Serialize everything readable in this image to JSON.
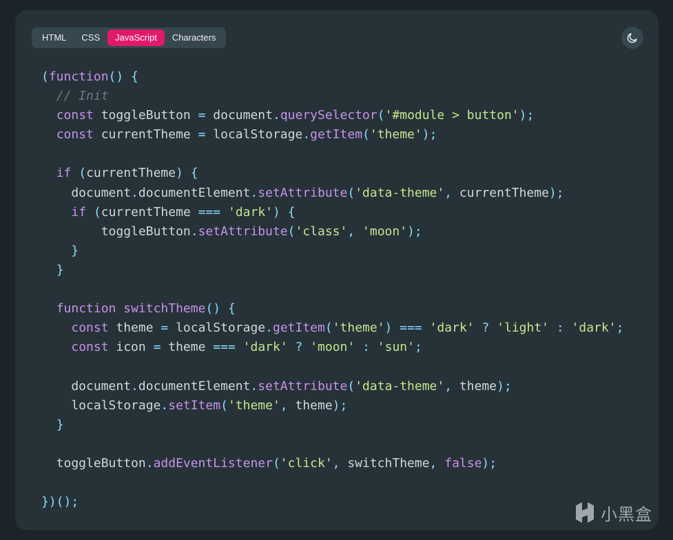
{
  "tabs": [
    {
      "label": "HTML",
      "active": false
    },
    {
      "label": "CSS",
      "active": false
    },
    {
      "label": "JavaScript",
      "active": true
    },
    {
      "label": "Characters",
      "active": false
    }
  ],
  "theme_toggle": {
    "icon": "moon-icon"
  },
  "colors": {
    "background": "#1b2428",
    "panel": "#263238",
    "tab_bar": "#37474f",
    "active_tab": "#e0196b",
    "keyword": "#c792ea",
    "string": "#c3e88d",
    "punctuation": "#89ddff",
    "comment": "#697b84",
    "text": "#cfd8dc"
  },
  "code": {
    "language": "JavaScript",
    "lines": [
      [
        [
          "punc",
          "("
        ],
        [
          "kw",
          "function"
        ],
        [
          "punc",
          "()"
        ],
        [
          "txt",
          " "
        ],
        [
          "punc",
          "{"
        ]
      ],
      [
        [
          "cm",
          "  // Init"
        ]
      ],
      [
        [
          "txt",
          "  "
        ],
        [
          "kw",
          "const"
        ],
        [
          "txt",
          " toggleButton "
        ],
        [
          "punc",
          "="
        ],
        [
          "txt",
          " document"
        ],
        [
          "dot",
          "."
        ],
        [
          "fn",
          "querySelector"
        ],
        [
          "punc",
          "("
        ],
        [
          "str",
          "'#module > button'"
        ],
        [
          "punc",
          ");"
        ]
      ],
      [
        [
          "txt",
          "  "
        ],
        [
          "kw",
          "const"
        ],
        [
          "txt",
          " currentTheme "
        ],
        [
          "punc",
          "="
        ],
        [
          "txt",
          " localStorage"
        ],
        [
          "dot",
          "."
        ],
        [
          "fn",
          "getItem"
        ],
        [
          "punc",
          "("
        ],
        [
          "str",
          "'theme'"
        ],
        [
          "punc",
          ");"
        ]
      ],
      [],
      [
        [
          "txt",
          "  "
        ],
        [
          "kw",
          "if"
        ],
        [
          "txt",
          " "
        ],
        [
          "punc",
          "("
        ],
        [
          "txt",
          "currentTheme"
        ],
        [
          "punc",
          ")"
        ],
        [
          "txt",
          " "
        ],
        [
          "punc",
          "{"
        ]
      ],
      [
        [
          "txt",
          "    document"
        ],
        [
          "dot",
          "."
        ],
        [
          "txt",
          "documentElement"
        ],
        [
          "dot",
          "."
        ],
        [
          "fn",
          "setAttribute"
        ],
        [
          "punc",
          "("
        ],
        [
          "str",
          "'data-theme'"
        ],
        [
          "punc",
          ","
        ],
        [
          "txt",
          " currentTheme"
        ],
        [
          "punc",
          ");"
        ]
      ],
      [
        [
          "txt",
          "    "
        ],
        [
          "kw",
          "if"
        ],
        [
          "txt",
          " "
        ],
        [
          "punc",
          "("
        ],
        [
          "txt",
          "currentTheme "
        ],
        [
          "punc",
          "==="
        ],
        [
          "txt",
          " "
        ],
        [
          "str",
          "'dark'"
        ],
        [
          "punc",
          ")"
        ],
        [
          "txt",
          " "
        ],
        [
          "punc",
          "{"
        ]
      ],
      [
        [
          "txt",
          "        toggleButton"
        ],
        [
          "dot",
          "."
        ],
        [
          "fn",
          "setAttribute"
        ],
        [
          "punc",
          "("
        ],
        [
          "str",
          "'class'"
        ],
        [
          "punc",
          ","
        ],
        [
          "txt",
          " "
        ],
        [
          "str",
          "'moon'"
        ],
        [
          "punc",
          ");"
        ]
      ],
      [
        [
          "txt",
          "    "
        ],
        [
          "punc",
          "}"
        ]
      ],
      [
        [
          "txt",
          "  "
        ],
        [
          "punc",
          "}"
        ]
      ],
      [],
      [
        [
          "txt",
          "  "
        ],
        [
          "kw",
          "function"
        ],
        [
          "txt",
          " "
        ],
        [
          "fn",
          "switchTheme"
        ],
        [
          "punc",
          "()"
        ],
        [
          "txt",
          " "
        ],
        [
          "punc",
          "{"
        ]
      ],
      [
        [
          "txt",
          "    "
        ],
        [
          "kw",
          "const"
        ],
        [
          "txt",
          " theme "
        ],
        [
          "punc",
          "="
        ],
        [
          "txt",
          " localStorage"
        ],
        [
          "dot",
          "."
        ],
        [
          "fn",
          "getItem"
        ],
        [
          "punc",
          "("
        ],
        [
          "str",
          "'theme'"
        ],
        [
          "punc",
          ")"
        ],
        [
          "txt",
          " "
        ],
        [
          "punc",
          "==="
        ],
        [
          "txt",
          " "
        ],
        [
          "str",
          "'dark'"
        ],
        [
          "txt",
          " "
        ],
        [
          "punc",
          "?"
        ],
        [
          "txt",
          " "
        ],
        [
          "str",
          "'light'"
        ],
        [
          "txt",
          " "
        ],
        [
          "punc",
          ":"
        ],
        [
          "txt",
          " "
        ],
        [
          "str",
          "'dark'"
        ],
        [
          "punc",
          ";"
        ]
      ],
      [
        [
          "txt",
          "    "
        ],
        [
          "kw",
          "const"
        ],
        [
          "txt",
          " icon "
        ],
        [
          "punc",
          "="
        ],
        [
          "txt",
          " theme "
        ],
        [
          "punc",
          "==="
        ],
        [
          "txt",
          " "
        ],
        [
          "str",
          "'dark'"
        ],
        [
          "txt",
          " "
        ],
        [
          "punc",
          "?"
        ],
        [
          "txt",
          " "
        ],
        [
          "str",
          "'moon'"
        ],
        [
          "txt",
          " "
        ],
        [
          "punc",
          ":"
        ],
        [
          "txt",
          " "
        ],
        [
          "str",
          "'sun'"
        ],
        [
          "punc",
          ";"
        ]
      ],
      [],
      [
        [
          "txt",
          "    document"
        ],
        [
          "dot",
          "."
        ],
        [
          "txt",
          "documentElement"
        ],
        [
          "dot",
          "."
        ],
        [
          "fn",
          "setAttribute"
        ],
        [
          "punc",
          "("
        ],
        [
          "str",
          "'data-theme'"
        ],
        [
          "punc",
          ","
        ],
        [
          "txt",
          " theme"
        ],
        [
          "punc",
          ");"
        ]
      ],
      [
        [
          "txt",
          "    localStorage"
        ],
        [
          "dot",
          "."
        ],
        [
          "fn",
          "setItem"
        ],
        [
          "punc",
          "("
        ],
        [
          "str",
          "'theme'"
        ],
        [
          "punc",
          ","
        ],
        [
          "txt",
          " theme"
        ],
        [
          "punc",
          ");"
        ]
      ],
      [
        [
          "txt",
          "  "
        ],
        [
          "punc",
          "}"
        ]
      ],
      [],
      [
        [
          "txt",
          "  toggleButton"
        ],
        [
          "dot",
          "."
        ],
        [
          "fn",
          "addEventListener"
        ],
        [
          "punc",
          "("
        ],
        [
          "str",
          "'click'"
        ],
        [
          "punc",
          ","
        ],
        [
          "txt",
          " switchTheme"
        ],
        [
          "punc",
          ","
        ],
        [
          "txt",
          " "
        ],
        [
          "kw",
          "false"
        ],
        [
          "punc",
          ");"
        ]
      ],
      [],
      [
        [
          "punc",
          "})();"
        ]
      ]
    ]
  },
  "watermark": {
    "text": "小黑盒",
    "icon": "heybox-logo-icon"
  }
}
